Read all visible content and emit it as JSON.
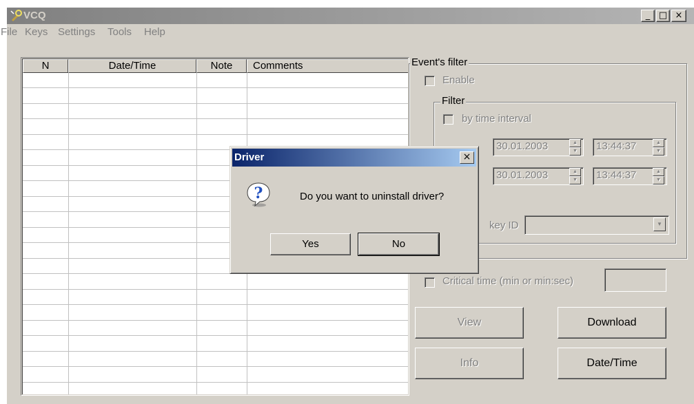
{
  "window": {
    "title": "VCQ",
    "minimize": "_",
    "maximize": "□",
    "close": "×"
  },
  "menu": [
    "File",
    "Keys",
    "Settings",
    "Tools",
    "Help"
  ],
  "table": {
    "columns": [
      "N",
      "Date/Time",
      "Note",
      "Comments"
    ],
    "rows": []
  },
  "filter": {
    "title": "Event's filter",
    "enable_label": "Enable",
    "enable_checked": false,
    "filter_group_title": "Filter",
    "by_time_label": "by time interval",
    "from_date": "30.01.2003",
    "from_time": "13:44:37",
    "to_date": "30.01.2003",
    "to_time": "13:44:37",
    "key_id_label": "key ID",
    "key_id_value": ""
  },
  "critical_time_label": "Critical time (min or min:sec)",
  "critical_time_value": "",
  "buttons": {
    "view": "View",
    "download": "Download",
    "info": "Info",
    "datetime": "Date/Time"
  },
  "dialog": {
    "title": "Driver",
    "message": "Do you want to uninstall driver?",
    "yes": "Yes",
    "no": "No",
    "close": "×",
    "icon": "question-icon"
  }
}
